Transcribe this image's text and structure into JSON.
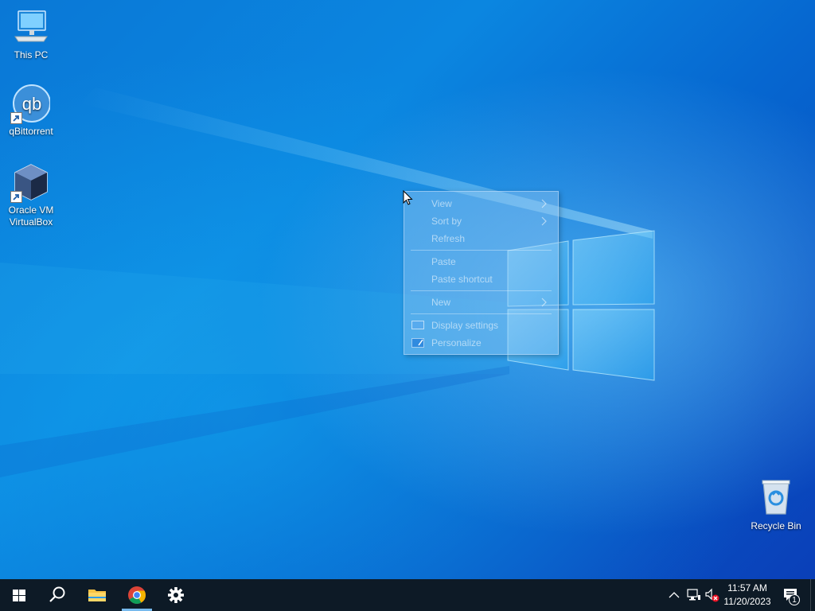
{
  "desktop": {
    "icons": [
      {
        "label": "This PC",
        "icon": "computer-icon"
      },
      {
        "label": "qBittorrent",
        "icon": "qbittorrent-icon",
        "glyph": "qb"
      },
      {
        "label": "Oracle VM VirtualBox",
        "icon": "virtualbox-icon"
      },
      {
        "label": "Recycle Bin",
        "icon": "recycle-bin-icon"
      }
    ]
  },
  "context_menu": {
    "items": [
      {
        "label": "View",
        "submenu": true
      },
      {
        "label": "Sort by",
        "submenu": true
      },
      {
        "label": "Refresh"
      },
      {
        "label": "Paste"
      },
      {
        "label": "Paste shortcut"
      },
      {
        "label": "New",
        "submenu": true
      },
      {
        "label": "Display settings",
        "icon": "display-icon"
      },
      {
        "label": "Personalize",
        "icon": "personalize-icon"
      }
    ]
  },
  "taskbar": {
    "buttons": [
      {
        "name": "start",
        "icon": "windows-logo-icon"
      },
      {
        "name": "search",
        "icon": "search-icon"
      },
      {
        "name": "file-explorer",
        "icon": "folder-icon"
      },
      {
        "name": "chrome",
        "icon": "chrome-icon",
        "active": true
      },
      {
        "name": "settings",
        "icon": "gear-icon"
      }
    ],
    "tray": {
      "time": "11:57 AM",
      "date": "11/20/2023",
      "notification_count": "1"
    }
  },
  "colors": {
    "taskbar_bg": "#0d1a26",
    "accent": "#76b9ed",
    "desktop_blue": "#0a78d6"
  }
}
